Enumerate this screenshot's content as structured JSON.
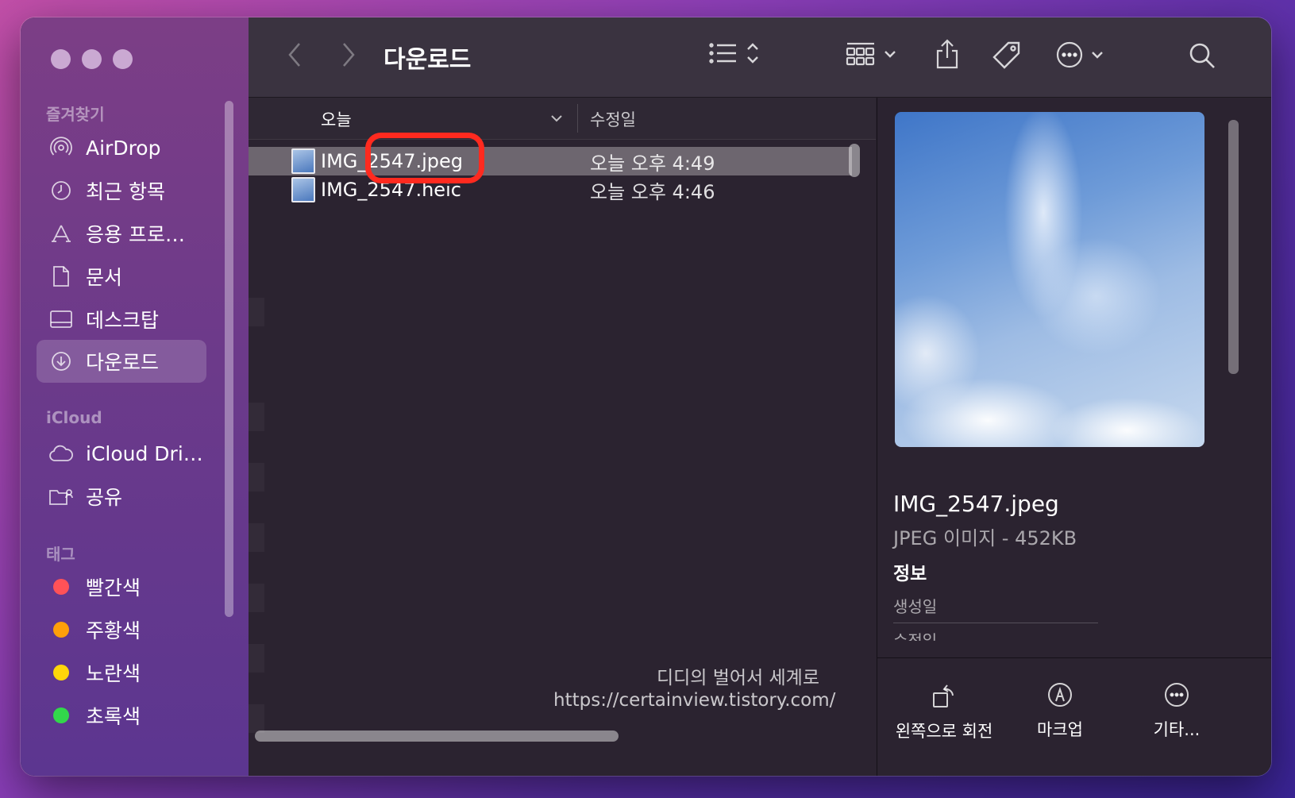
{
  "sidebar": {
    "sections": {
      "favorites": "즐겨찾기",
      "icloud": "iCloud",
      "tags": "태그"
    },
    "favorites": [
      {
        "label": "AirDrop",
        "icon": "airdrop-icon"
      },
      {
        "label": "최근 항목",
        "icon": "clock-icon"
      },
      {
        "label": "응용 프로…",
        "icon": "applications-icon"
      },
      {
        "label": "문서",
        "icon": "document-icon"
      },
      {
        "label": "데스크탑",
        "icon": "desktop-icon"
      },
      {
        "label": "다운로드",
        "icon": "download-icon"
      }
    ],
    "icloud_items": [
      {
        "label": "iCloud Dri…",
        "icon": "cloud-icon"
      },
      {
        "label": "공유",
        "icon": "shared-folder-icon"
      }
    ],
    "tags": [
      {
        "label": "빨간색",
        "color": "#ff5257"
      },
      {
        "label": "주황색",
        "color": "#ff9f0a"
      },
      {
        "label": "노란색",
        "color": "#ffd60a"
      },
      {
        "label": "초록색",
        "color": "#32d74b"
      }
    ]
  },
  "toolbar": {
    "title": "다운로드"
  },
  "list": {
    "columns": {
      "name": "오늘",
      "date": "수정일"
    },
    "rows": [
      {
        "name": "IMG_2547.jpeg",
        "date": "오늘 오후 4:49",
        "selected": true
      },
      {
        "name": "IMG_2547.heic",
        "date": "오늘 오후 4:46",
        "selected": false
      }
    ]
  },
  "watermark": {
    "line1": "디디의 벌어서 세계로",
    "line2": "https://certainview.tistory.com/"
  },
  "preview": {
    "filename": "IMG_2547.jpeg",
    "type": "JPEG 이미지 - 452KB",
    "info_heading": "정보",
    "created_label": "생성일",
    "modified_label": "수정일",
    "actions": [
      {
        "label": "왼쪽으로 회전",
        "icon": "rotate-left-icon"
      },
      {
        "label": "마크업",
        "icon": "markup-icon"
      },
      {
        "label": "기타...",
        "icon": "more-icon"
      }
    ]
  },
  "colors": {
    "selection": "#6d666f",
    "highlight_ring": "#ff2a1f"
  }
}
